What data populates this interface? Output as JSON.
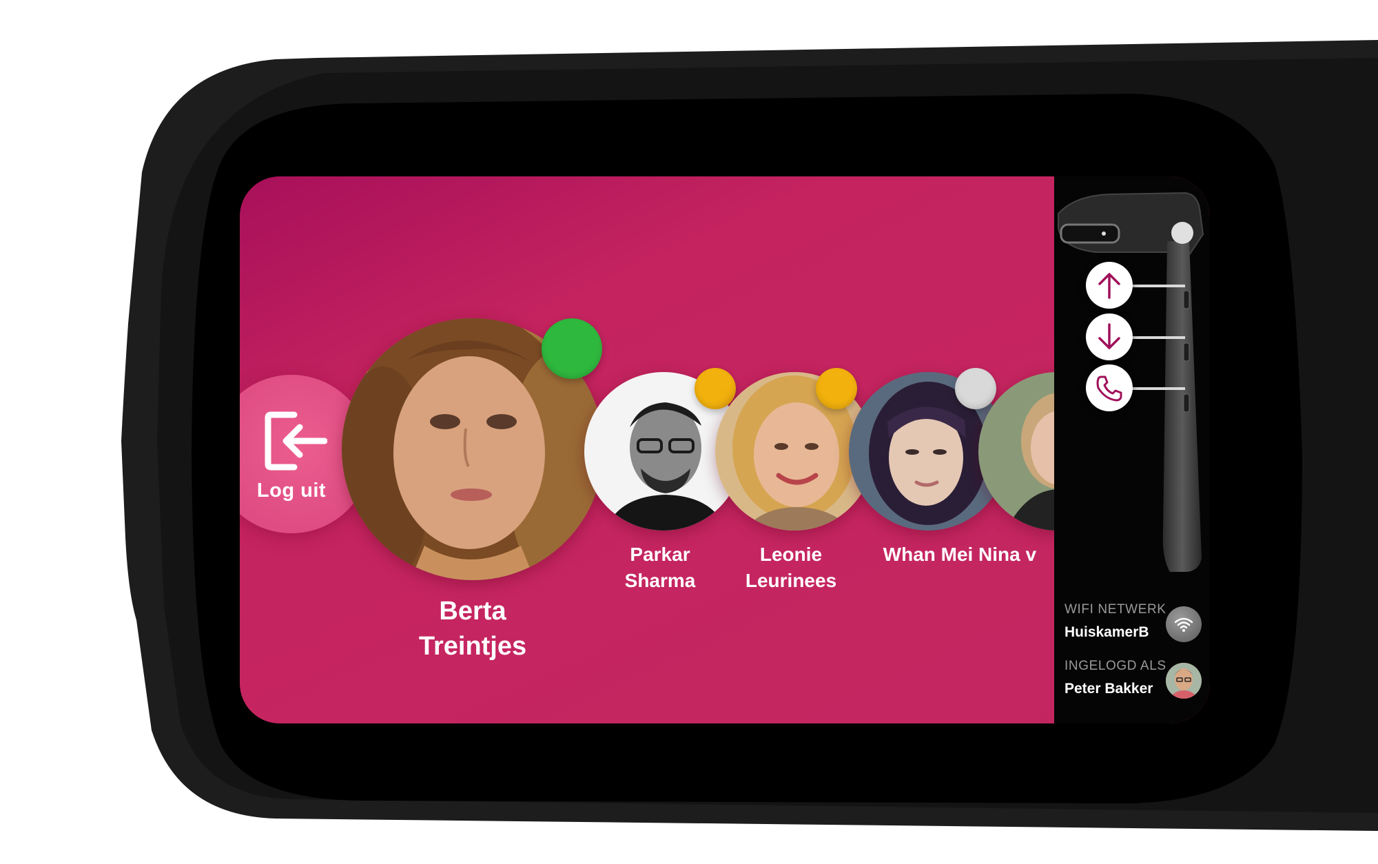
{
  "logout": {
    "label": "Log uit",
    "icon": "logout-icon"
  },
  "contacts": [
    {
      "first": "Berta",
      "last": "Treintjes",
      "status_color": "#2fb83e",
      "selected": true
    },
    {
      "first": "Parkar",
      "last": "Sharma",
      "status_color": "#f2b10d"
    },
    {
      "first": "Leonie",
      "last": "Leurinees",
      "status_color": "#f2b10d"
    },
    {
      "first": "Whan Mei",
      "last": "",
      "status_color": "#d9d9d9"
    },
    {
      "first": "Nina v",
      "last": "",
      "status_color": ""
    }
  ],
  "controls": {
    "up_icon": "arrow-up-icon",
    "down_icon": "arrow-down-icon",
    "call_icon": "phone-icon"
  },
  "status": {
    "wifi_caption": "WIFI NETWERK",
    "wifi_name": "HuiskamerB",
    "wifi_icon": "wifi-icon",
    "login_caption": "INGELOGD ALS",
    "user_name": "Peter Bakker"
  },
  "colors": {
    "brand": "#c52560",
    "accent_icon": "#a0105a",
    "online": "#2fb83e",
    "away": "#f2b10d",
    "offline": "#d9d9d9"
  }
}
